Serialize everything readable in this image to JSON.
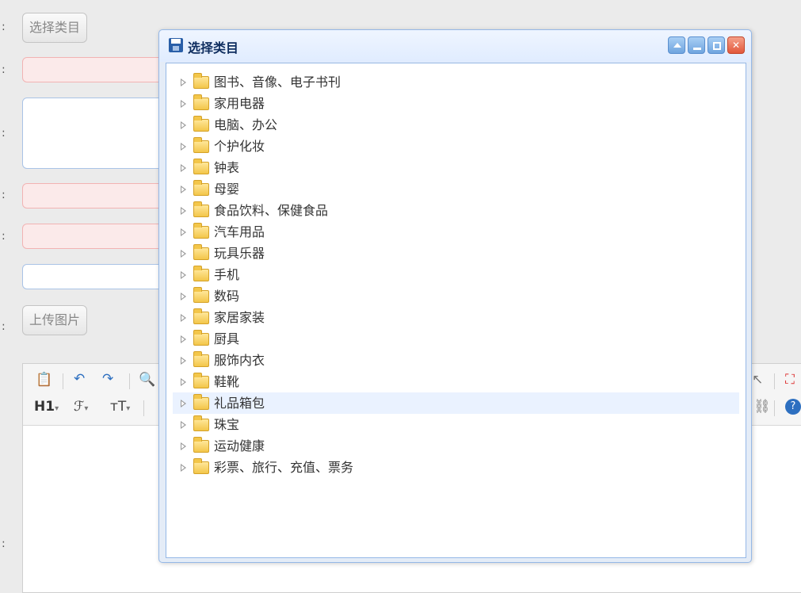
{
  "form": {
    "colon": ":",
    "select_category_label": "选择类目",
    "upload_image_label": "上传图片"
  },
  "editor": {
    "heading_label": "H1",
    "font_family_label": "ℱ",
    "font_size_label": "тT",
    "help_icon_char": "?"
  },
  "dialog": {
    "title": "选择类目",
    "close_char": "✕"
  },
  "tree": {
    "nodes": [
      "图书、音像、电子书刊",
      "家用电器",
      "电脑、办公",
      "个护化妆",
      "钟表",
      "母婴",
      "食品饮料、保健食品",
      "汽车用品",
      "玩具乐器",
      "手机",
      "数码",
      "家居家装",
      "厨具",
      "服饰内衣",
      "鞋靴",
      "礼品箱包",
      "珠宝",
      "运动健康",
      "彩票、旅行、充值、票务"
    ],
    "hovered_index": 15
  },
  "colors": {
    "dialog_border": "#95b8e7",
    "dialog_header": "#e0ecff",
    "hover_row": "#eaf2ff",
    "error_field": "#fbeaea"
  }
}
